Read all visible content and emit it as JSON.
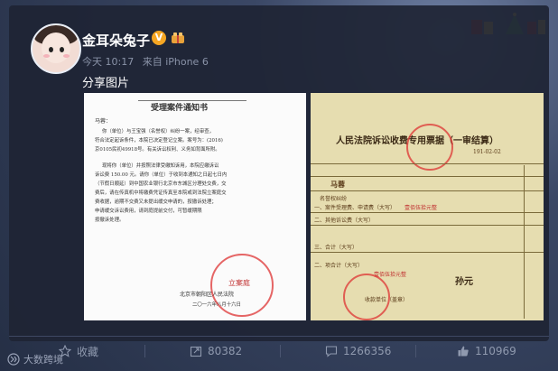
{
  "post": {
    "author": "金耳朵兔子",
    "timestamp": "今天 10:17",
    "source": "来自 iPhone 6",
    "text": "分享图片"
  },
  "left_image": {
    "header_title": "受理案件通知书",
    "addressee": "马蓉：",
    "body": [
      "你（单位）与王宝强（名誉权）纠纷一案，经审查，",
      "符合法定起诉条件，本院已决定登记立案。案号为：(2016)",
      "京0105民初49918号。有关诉讼权利、义务如背面所附。",
      "现将你（单位）并按照法律受缴知诉用，本院应缴诉讼",
      "诉讼费 150.00 元。请你（单位）于收到本通知之日起七日内",
      "（节假日顺延）到中国农业银行北京市东城区分理处交费，交",
      "费后，请在传真机中将缴费凭证传真至本院或到法院立案庭交",
      "费收据，逾期不交费又未提出缓交申请的，按撤诉处理；",
      "申请缓交诉讼费用，请到庭提前交付，可暂缓期限",
      "按撤诉处理。"
    ],
    "footer": "北京市朝阳区人民法院",
    "date": "二〇一六年八月十六日",
    "stamp_text": "立案庭"
  },
  "right_image": {
    "title": "人民法院诉讼收费专用票据（一审结算）",
    "number": "191-02-02",
    "payer": "马蓉",
    "row1": "名誉权纠纷",
    "row2": "一、案件受理费、申请费（大写）",
    "row2_red": "壹佰伍拾元整",
    "row3": "二、其他诉讼费（大写）",
    "row4": "三、合计（大写）",
    "row5": "二、项合计（大写）",
    "row5_red": "壹佰伍拾元整",
    "payee": "孙元",
    "unit": "收款单位（盖章）"
  },
  "actions": {
    "favorite": "收藏",
    "repost": "80382",
    "comment": "1266356",
    "like": "110969"
  },
  "watermark": "大数跨境",
  "colors": {
    "vip_badge": "#f5a623",
    "stamp_red": "#d33333"
  }
}
